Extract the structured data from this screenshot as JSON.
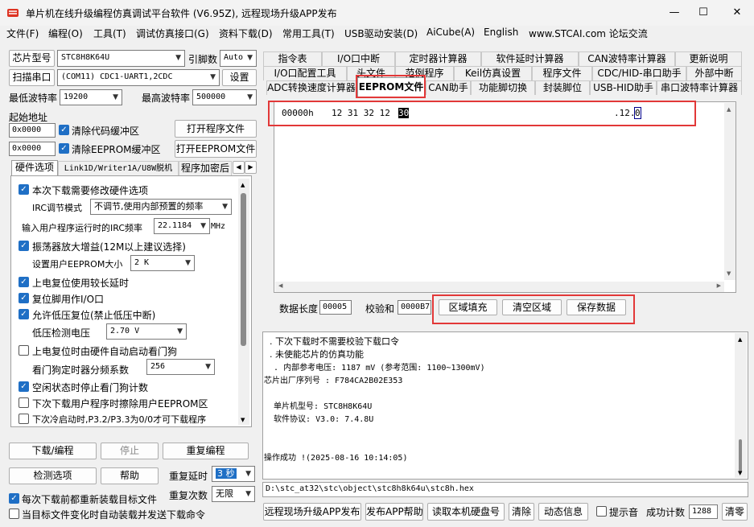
{
  "window": {
    "title": "单片机在线升级编程仿真调试平台软件 (V6.95Z), 远程现场升级APP发布"
  },
  "menu": [
    "文件(F)",
    "编程(O)",
    "工具(T)",
    "调试仿真接口(G)",
    "资料下载(D)",
    "常用工具(T)",
    "USB驱动安装(D)",
    "AiCube(A)",
    "English",
    "www.STCAI.com 论坛交流"
  ],
  "left": {
    "chip_label": "芯片型号",
    "chip_value": "STC8H8K64U",
    "pin_label": "引脚数",
    "pin_value": "Auto",
    "scan_button": "扫描串口",
    "port_value": "(COM11) CDC1-UART1,2CDC",
    "settings_button": "设置",
    "min_baud_label": "最低波特率",
    "min_baud_value": "19200",
    "max_baud_label": "最高波特率",
    "max_baud_value": "500000",
    "start_addr_label": "起始地址",
    "code_addr": "0x0000",
    "clear_code_label": "清除代码缓冲区",
    "open_program_button": "打开程序文件",
    "eeprom_addr": "0x0000",
    "clear_eeprom_label": "清除EEPROM缓冲区",
    "open_eeprom_button": "打开EEPROM文件",
    "tabs": [
      "硬件选项",
      "Link1D/Writer1A/U8W脱机",
      "程序加密后"
    ],
    "options": {
      "modify_hw": "本次下载需要修改硬件选项",
      "irc_mode_label": "IRC调节模式",
      "irc_mode_value": "不调节,使用内部预置的频率",
      "irc_freq_label": "输入用户程序运行时的IRC频率",
      "irc_freq_value": "22.1184",
      "irc_freq_unit": "MHz",
      "osc_gain": "振荡器放大增益(12M以上建议选择)",
      "eeprom_size_label": "设置用户EEPROM大小",
      "eeprom_size_value": "2    K",
      "power_reset_delay": "上电复位使用较长延时",
      "reset_pin_io": "复位脚用作I/O口",
      "lvd_reset": "允许低压复位(禁止低压中断)",
      "lvd_voltage_label": "低压检测电压",
      "lvd_voltage_value": "2.70 V",
      "wdt_start": "上电复位时由硬件自动启动看门狗",
      "wdt_prescale_label": "看门狗定时器分频系数",
      "wdt_prescale_value": "256",
      "idle_stop_wdt": "空闲状态时停止看门狗计数",
      "erase_eeprom": "下次下载用户程序时擦除用户EEPROM区",
      "cold_start": "下次冷启动时,P3.2/P3.3为0/0才可下载程序"
    },
    "download_button": "下载/编程",
    "stop_button": "停止",
    "reprogram_button": "重复编程",
    "detect_button": "检测选项",
    "help_button": "帮助",
    "repeat_delay_label": "重复延时",
    "repeat_delay_value": "3 秒",
    "repeat_count_label": "重复次数",
    "repeat_count_value": "无限",
    "reload_label": "每次下载前都重新装载目标文件",
    "auto_send_label": "当目标文件变化时自动装载并发送下载命令"
  },
  "right": {
    "tabs_row1": [
      "指令表",
      "I/O口中断",
      "定时器计算器",
      "软件延时计算器",
      "CAN波特率计算器",
      "更新说明"
    ],
    "tabs_row2": [
      "I/O口配置工具",
      "头文件",
      "范例程序",
      "Keil仿真设置",
      "程序文件",
      "CDC/HID-串口助手",
      "外部中断"
    ],
    "tabs_row3": [
      "ADC转换速度计算器",
      "EEPROM文件",
      "CAN助手",
      "功能脚切换",
      "封装脚位",
      "USB-HID助手",
      "串口波特率计算器"
    ],
    "hex": {
      "address": "00000h",
      "bytes": "12 31 32 12",
      "cursor_byte": "30",
      "ascii": ".12.",
      "ascii_cursor": "0"
    },
    "data_len_label": "数据长度",
    "data_len_value": "00005",
    "checksum_label": "校验和",
    "checksum_value": "0000B7",
    "fill_button": "区域填充",
    "clear_button": "清空区域",
    "save_button": "保存数据",
    "log": [
      "  . 下次下载时不需要校验下载口令",
      "  . 未使能芯片的仿真功能",
      "  . 内部参考电压: 1187 mV (参考范围: 1100~1300mV)",
      "芯片出厂序列号 : F784CA2B02E353",
      "",
      "  单片机型号: STC8H8K64U",
      "  软件协议: V3.0: 7.4.8U",
      "",
      "",
      "操作成功 !(2025-08-16 10:14:05)"
    ],
    "path": "D:\\stc_at32\\stc\\object\\stc8h8k64u\\stc8h.hex",
    "publish_button": "远程现场升级APP发布",
    "publish_help_button": "发布APP帮助",
    "read_disk_button": "读取本机硬盘号",
    "clear_log_button": "清除",
    "dynamic_button": "动态信息",
    "beep_label": "提示音",
    "success_label": "成功计数",
    "success_value": "1288",
    "clear_count_button": "清零"
  }
}
